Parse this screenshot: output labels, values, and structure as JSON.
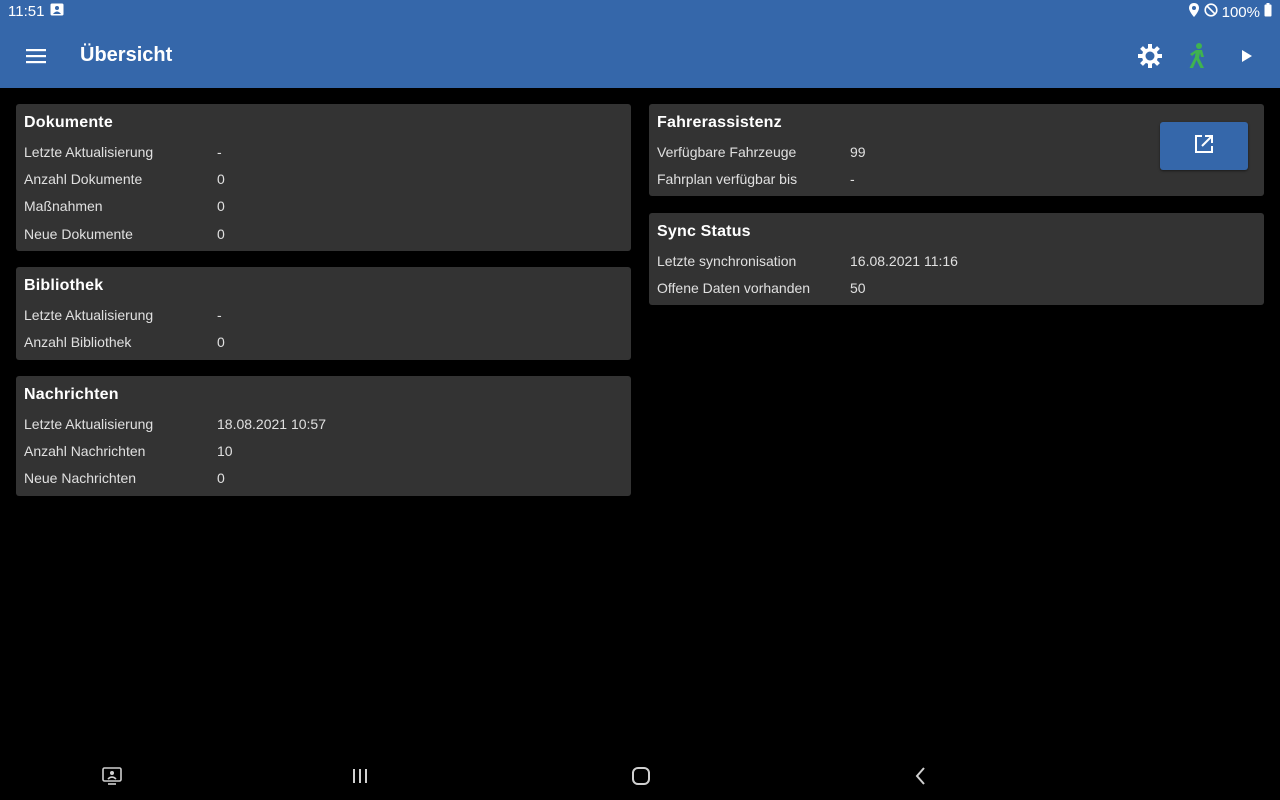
{
  "status_bar": {
    "time": "11:51",
    "battery": "100%",
    "icons": [
      "notification-icon",
      "location-icon",
      "do-not-disturb-icon",
      "battery-icon"
    ]
  },
  "app_bar": {
    "title": "Übersicht",
    "actions": [
      "settings-icon",
      "walking-person-icon",
      "play-icon"
    ],
    "color": "#3567aa",
    "accent_green": "#3fb34f"
  },
  "dokumente": {
    "title": "Dokumente",
    "rows": [
      {
        "label": "Letzte Aktualisierung",
        "value": "-"
      },
      {
        "label": "Anzahl Dokumente",
        "value": "0"
      },
      {
        "label": "Maßnahmen",
        "value": "0"
      },
      {
        "label": "Neue Dokumente",
        "value": "0"
      }
    ]
  },
  "bibliothek": {
    "title": "Bibliothek",
    "rows": [
      {
        "label": "Letzte Aktualisierung",
        "value": "-"
      },
      {
        "label": "Anzahl Bibliothek",
        "value": "0"
      }
    ]
  },
  "nachrichten": {
    "title": "Nachrichten",
    "rows": [
      {
        "label": "Letzte Aktualisierung",
        "value": "18.08.2021 10:57"
      },
      {
        "label": "Anzahl Nachrichten",
        "value": "10"
      },
      {
        "label": "Neue Nachrichten",
        "value": "0"
      }
    ]
  },
  "fahrerassistenz": {
    "title": "Fahrerassistenz",
    "rows": [
      {
        "label": "Verfügbare Fahrzeuge",
        "value": "99"
      },
      {
        "label": "Fahrplan verfügbar bis",
        "value": "-"
      }
    ],
    "button_icon": "open-external-icon"
  },
  "sync_status": {
    "title": "Sync Status",
    "rows": [
      {
        "label": "Letzte synchronisation",
        "value": "16.08.2021 11:16"
      },
      {
        "label": "Offene Daten vorhanden",
        "value": "50"
      }
    ]
  },
  "nav_bar": {
    "icons": [
      "screen-share-icon",
      "recent-apps-icon",
      "home-icon",
      "back-icon"
    ]
  }
}
